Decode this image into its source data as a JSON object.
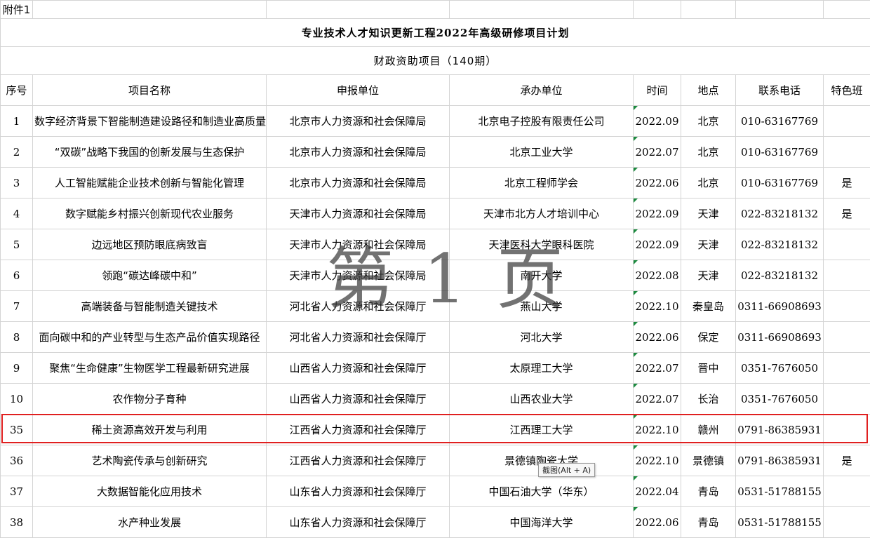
{
  "attachment_label": "附件1",
  "title": "专业技术人才知识更新工程2022年高级研修项目计划",
  "subtitle": "财政资助项目（140期）",
  "headers": {
    "no": "序号",
    "project": "项目名称",
    "applicant": "申报单位",
    "organizer": "承办单位",
    "time": "时间",
    "location": "地点",
    "phone": "联系电话",
    "special": "特色班"
  },
  "rows": [
    {
      "no": "1",
      "project": "数字经济背景下智能制造建设路径和制造业高质量发展",
      "applicant": "北京市人力资源和社会保障局",
      "organizer": "北京电子控股有限责任公司",
      "time": "2022.09",
      "location": "北京",
      "phone": "010-63167769",
      "special": ""
    },
    {
      "no": "2",
      "project": "“双碳”战略下我国的创新发展与生态保护",
      "applicant": "北京市人力资源和社会保障局",
      "organizer": "北京工业大学",
      "time": "2022.07",
      "location": "北京",
      "phone": "010-63167769",
      "special": ""
    },
    {
      "no": "3",
      "project": "人工智能赋能企业技术创新与智能化管理",
      "applicant": "北京市人力资源和社会保障局",
      "organizer": "北京工程师学会",
      "time": "2022.06",
      "location": "北京",
      "phone": "010-63167769",
      "special": "是"
    },
    {
      "no": "4",
      "project": "数字赋能乡村振兴创新现代农业服务",
      "applicant": "天津市人力资源和社会保障局",
      "organizer": "天津市北方人才培训中心",
      "time": "2022.09",
      "location": "天津",
      "phone": "022-83218132",
      "special": "是"
    },
    {
      "no": "5",
      "project": "边远地区预防眼底病致盲",
      "applicant": "天津市人力资源和社会保障局",
      "organizer": "天津医科大学眼科医院",
      "time": "2022.09",
      "location": "天津",
      "phone": "022-83218132",
      "special": ""
    },
    {
      "no": "6",
      "project": "领跑“碳达峰碳中和”",
      "applicant": "天津市人力资源和社会保障局",
      "organizer": "南开大学",
      "time": "2022.08",
      "location": "天津",
      "phone": "022-83218132",
      "special": ""
    },
    {
      "no": "7",
      "project": "高端装备与智能制造关键技术",
      "applicant": "河北省人力资源和社会保障厅",
      "organizer": "燕山大学",
      "time": "2022.10",
      "location": "秦皇岛",
      "phone": "0311-66908693",
      "special": ""
    },
    {
      "no": "8",
      "project": "面向碳中和的产业转型与生态产品价值实现路径",
      "applicant": "河北省人力资源和社会保障厅",
      "organizer": "河北大学",
      "time": "2022.06",
      "location": "保定",
      "phone": "0311-66908693",
      "special": ""
    },
    {
      "no": "9",
      "project": "聚焦“生命健康”生物医学工程最新研究进展",
      "applicant": "山西省人力资源和社会保障厅",
      "organizer": "太原理工大学",
      "time": "2022.07",
      "location": "晋中",
      "phone": "0351-7676050",
      "special": ""
    },
    {
      "no": "10",
      "project": "农作物分子育种",
      "applicant": "山西省人力资源和社会保障厅",
      "organizer": "山西农业大学",
      "time": "2022.07",
      "location": "长治",
      "phone": "0351-7676050",
      "special": ""
    },
    {
      "no": "35",
      "project": "稀土资源高效开发与利用",
      "applicant": "江西省人力资源和社会保障厅",
      "organizer": "江西理工大学",
      "time": "2022.10",
      "location": "赣州",
      "phone": "0791-86385931",
      "special": ""
    },
    {
      "no": "36",
      "project": "艺术陶瓷传承与创新研究",
      "applicant": "江西省人力资源和社会保障厅",
      "organizer": "景德镇陶瓷大学",
      "time": "2022.10",
      "location": "景德镇",
      "phone": "0791-86385931",
      "special": "是"
    },
    {
      "no": "37",
      "project": "大数据智能化应用技术",
      "applicant": "山东省人力资源和社会保障厅",
      "organizer": "中国石油大学（华东）",
      "time": "2022.04",
      "location": "青岛",
      "phone": "0531-51788155",
      "special": ""
    },
    {
      "no": "38",
      "project": "水产种业发展",
      "applicant": "山东省人力资源和社会保障厅",
      "organizer": "中国海洋大学",
      "time": "2022.06",
      "location": "青岛",
      "phone": "0531-51788155",
      "special": ""
    }
  ],
  "watermark": "第 1 页",
  "tooltip": "截图(Alt + A)",
  "colors": {
    "highlight": "#e02020",
    "cell_marker": "#1b8a3e"
  }
}
